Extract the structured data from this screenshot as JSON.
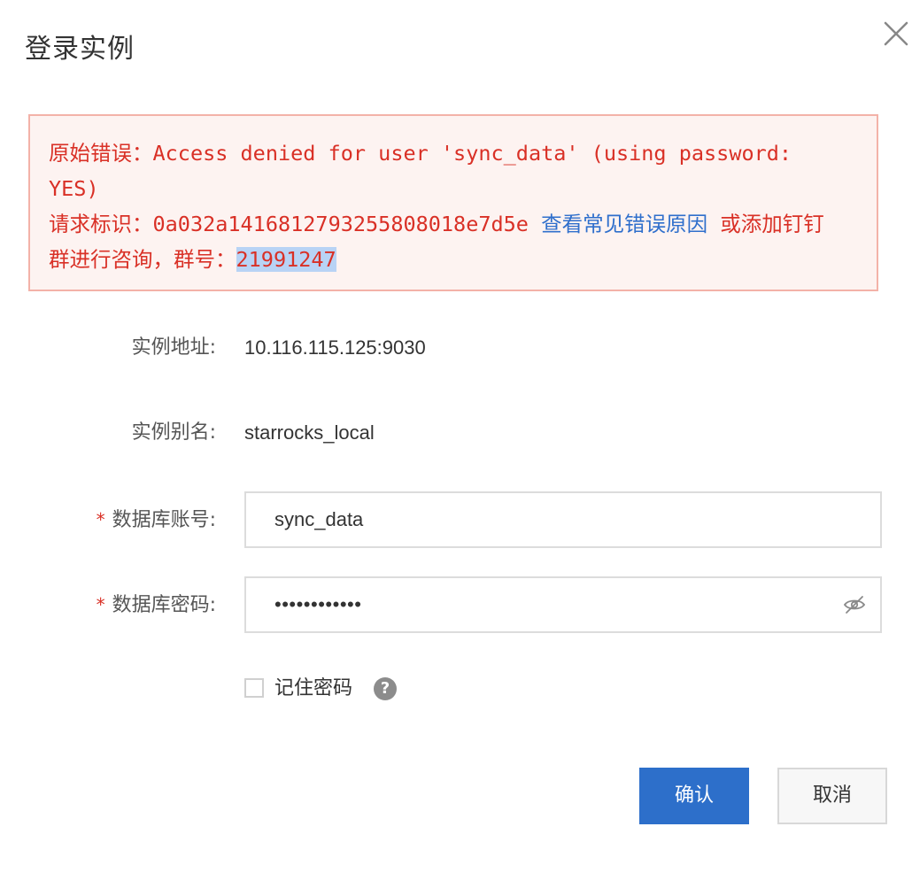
{
  "dialog": {
    "title": "登录实例",
    "close_icon": "close-icon"
  },
  "error": {
    "line1": "原始错误：Access denied for user 'sync_data' (using password:",
    "line2": "YES)",
    "request_id_label": "请求标识：0a032a141681279325580801 8e7d5e",
    "request_id_prefix": "请求标识：",
    "request_id": "0a032a1416812793255808018e7d5e",
    "link_text": "查看常见错误原因",
    "suffix": " 或添加钉钉",
    "line4_prefix": "群进行咨询，群号：",
    "group_number": "21991247",
    "colors": {
      "text": "#d93026",
      "link": "#2f6fcc",
      "border": "#f3b2a8",
      "background": "#fdf3f1"
    }
  },
  "form": {
    "address_label": "实例地址:",
    "address_value": "10.116.115.125:9030",
    "alias_label": "实例别名:",
    "alias_value": "starrocks_local",
    "account_label": "数据库账号:",
    "account_value": "sync_data",
    "password_label": "数据库密码:",
    "password_value": "••••••••••••",
    "required_mark": "*",
    "eye_icon": "eye-off-icon"
  },
  "remember": {
    "label": "记住密码",
    "checked": false,
    "help_icon": "question-circle-icon",
    "help_glyph": "?"
  },
  "buttons": {
    "confirm": "确认",
    "cancel": "取消",
    "primary_color": "#2d6fca"
  }
}
